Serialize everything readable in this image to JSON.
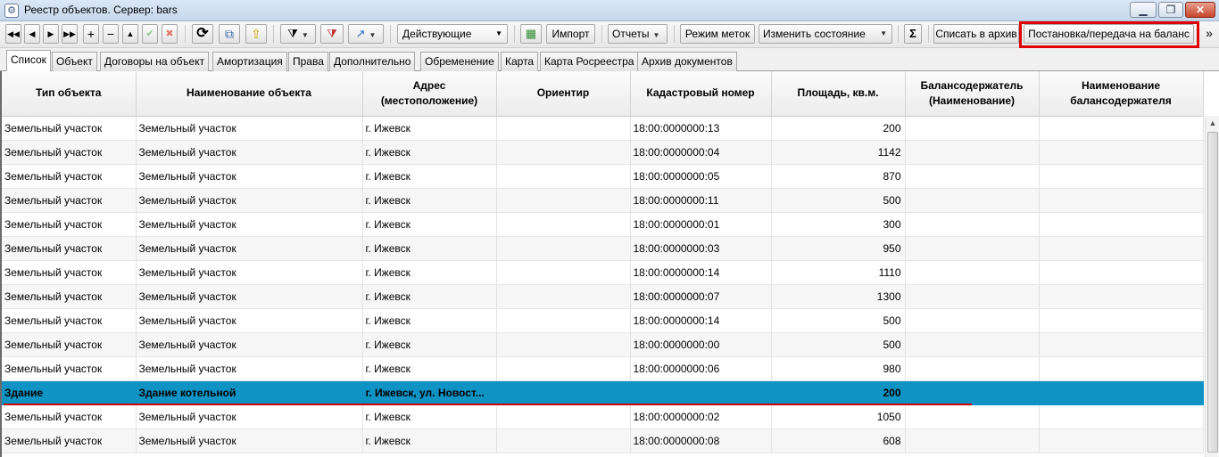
{
  "window": {
    "title": "Реестр объектов. Сервер: bars",
    "minimize": "▁",
    "maximize": "❐",
    "close": "✕"
  },
  "toolbar": {
    "filter_value": "Действующие",
    "import_label": "Импорт",
    "reports_label": "Отчеты",
    "tags_mode_label": "Режим меток",
    "change_state_label": "Изменить состояние",
    "sum_label": "Σ",
    "archive_label": "Списать в архив",
    "balance_label": "Постановка/передача на баланс",
    "more_label": "»",
    "icons": {
      "first": "◀◀",
      "prev": "◀",
      "next": "▶",
      "last": "▶▶",
      "add": "+",
      "remove": "−",
      "up": "▲",
      "confirm": "✔",
      "cancel": "✖",
      "refresh": "⟳",
      "copy": "⧉",
      "export": "⇪",
      "filter": "⧩",
      "clear_filter": "⧩",
      "arrow": "↗",
      "excel": "▦"
    }
  },
  "tabs": [
    "Список",
    "Объект",
    "Договоры на объект",
    "Амортизация",
    "Права",
    "Дополнительно",
    "Обременение",
    "Карта",
    "Карта Росреестра",
    "Архив документов"
  ],
  "table": {
    "columns": [
      "Тип объекта",
      "Наименование объекта",
      "Адрес (местоположение)",
      "Ориентир",
      "Кадастровый номер",
      "Площадь, кв.м.",
      "Балансодержатель (Наименование)",
      "Наименование балансодержателя"
    ],
    "rows": [
      [
        "Земельный участок",
        "Земельный участок",
        "г. Ижевск",
        "",
        "18:00:0000000:13",
        "200",
        "",
        ""
      ],
      [
        "Земельный участок",
        "Земельный участок",
        "г. Ижевск",
        "",
        "18:00:0000000:04",
        "1142",
        "",
        ""
      ],
      [
        "Земельный участок",
        "Земельный участок",
        "г. Ижевск",
        "",
        "18:00:0000000:05",
        "870",
        "",
        ""
      ],
      [
        "Земельный участок",
        "Земельный участок",
        "г. Ижевск",
        "",
        "18:00:0000000:11",
        "500",
        "",
        ""
      ],
      [
        "Земельный участок",
        "Земельный участок",
        "г. Ижевск",
        "",
        "18:00:0000000:01",
        "300",
        "",
        ""
      ],
      [
        "Земельный участок",
        "Земельный участок",
        "г. Ижевск",
        "",
        "18:00:0000000:03",
        "950",
        "",
        ""
      ],
      [
        "Земельный участок",
        "Земельный участок",
        "г. Ижевск",
        "",
        "18:00:0000000:14",
        "1110",
        "",
        ""
      ],
      [
        "Земельный участок",
        "Земельный участок",
        "г. Ижевск",
        "",
        "18:00:0000000:07",
        "1300",
        "",
        ""
      ],
      [
        "Земельный участок",
        "Земельный участок",
        "г. Ижевск",
        "",
        "18:00:0000000:14",
        "500",
        "",
        ""
      ],
      [
        "Земельный участок",
        "Земельный участок",
        "г. Ижевск",
        "",
        "18:00:0000000:00",
        "500",
        "",
        ""
      ],
      [
        "Земельный участок",
        "Земельный участок",
        "г. Ижевск",
        "",
        "18:00:0000000:06",
        "980",
        "",
        ""
      ],
      [
        "Здание",
        "Здание котельной",
        "г. Ижевск, ул. Новост...",
        "",
        "",
        "200",
        "",
        ""
      ],
      [
        "Земельный участок",
        "Земельный участок",
        "г. Ижевск",
        "",
        "18:00:0000000:02",
        "1050",
        "",
        ""
      ],
      [
        "Земельный участок",
        "Земельный участок",
        "г. Ижевск",
        "",
        "18:00:0000000:08",
        "608",
        "",
        ""
      ]
    ],
    "selected_row": 11
  },
  "colors": {
    "selection": "#0f93c4",
    "highlight": "#e00000"
  }
}
